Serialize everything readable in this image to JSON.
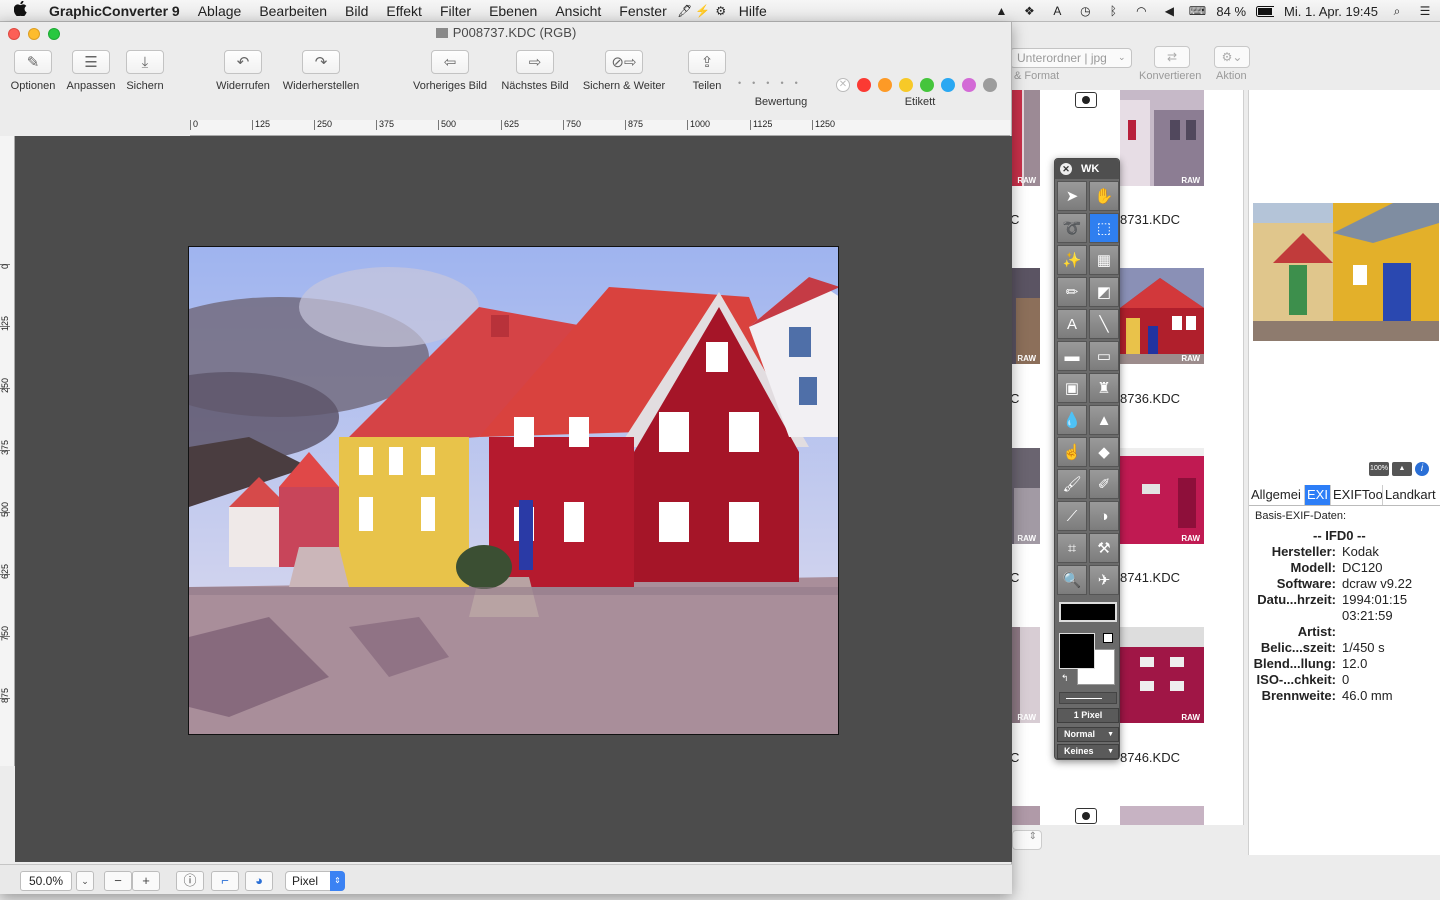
{
  "menubar": {
    "apple": "",
    "items": [
      "GraphicConverter 9",
      "Ablage",
      "Bearbeiten",
      "Bild",
      "Effekt",
      "Filter",
      "Ebenen",
      "Ansicht",
      "Fenster",
      "Hilfe"
    ],
    "battery": "84 %",
    "clock": "Mi. 1. Apr.  19:45"
  },
  "window": {
    "title": "P008737.KDC (RGB)"
  },
  "toolbar": {
    "optionen": "Optionen",
    "anpassen": "Anpassen",
    "sichern": "Sichern",
    "widerrufen": "Widerrufen",
    "widerherstellen": "Widerherstellen",
    "vorheriges": "Vorheriges Bild",
    "naechstes": "Nächstes Bild",
    "sichern_weiter": "Sichern & Weiter",
    "teilen": "Teilen",
    "bewertung": "Bewertung",
    "etikett": "Etikett"
  },
  "label_colors": [
    "#fb3a33",
    "#fd9a26",
    "#f7c928",
    "#45c53c",
    "#2aa8f2",
    "#d36ad6",
    "#9c9c9c"
  ],
  "ruler": {
    "h": [
      "0",
      "125",
      "250",
      "375",
      "500",
      "625",
      "750",
      "875",
      "1000",
      "1125",
      "1250"
    ],
    "v": [
      "0",
      "125",
      "250",
      "375",
      "500",
      "625",
      "750",
      "875"
    ]
  },
  "statusbar": {
    "zoom": "50.0%",
    "unit": "Pixel"
  },
  "palette": {
    "title": "WK",
    "line_width": "1 Pixel",
    "mode": "Normal",
    "fill": "Keines"
  },
  "browser": {
    "folder": "Unterordner | jpg",
    "format_label": "& Format",
    "konvertieren": "Konvertieren",
    "aktion": "Aktion",
    "raw": "RAW",
    "thumbs": [
      "8731.KDC",
      "8736.KDC",
      "8741.KDC",
      "8746.KDC"
    ],
    "col_c": "C"
  },
  "inspector": {
    "tabs": [
      "Allgemei",
      "EXI",
      "EXIFToo",
      "Landkart"
    ],
    "active_tab": 1,
    "exif_heading": "Basis-EXIF-Daten:",
    "ifd": "-- IFD0 --",
    "rows": [
      {
        "k": "Hersteller:",
        "v": "Kodak"
      },
      {
        "k": "Modell:",
        "v": "DC120"
      },
      {
        "k": "Software:",
        "v": "dcraw v9.22"
      },
      {
        "k": "Datu...hrzeit:",
        "v": "1994:01:15"
      },
      {
        "k": "",
        "v": "03:21:59"
      },
      {
        "k": "Artist:",
        "v": ""
      },
      {
        "k": "Belic...szeit:",
        "v": "1/450 s"
      },
      {
        "k": "Blend...llung:",
        "v": "12.0"
      },
      {
        "k": "ISO-...chkeit:",
        "v": "0"
      },
      {
        "k": "Brennweite:",
        "v": "46.0 mm"
      }
    ],
    "badge": "100%"
  }
}
